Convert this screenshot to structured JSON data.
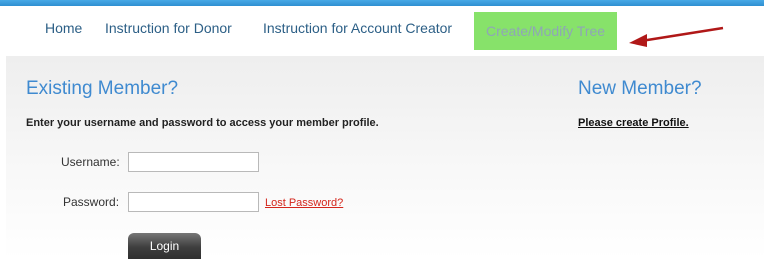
{
  "nav": {
    "items": [
      {
        "label": "Home"
      },
      {
        "label": "Instruction for Donor"
      },
      {
        "label": "Instruction for Account Creator"
      },
      {
        "label": "Create/Modify Tree"
      }
    ],
    "active_color": "#87e26a",
    "arrow_color": "#b01818"
  },
  "existing": {
    "heading": "Existing Member?",
    "instructions": "Enter your username and password to access your member profile.",
    "username_label": "Username:",
    "username_value": "",
    "password_label": "Password:",
    "password_value": "",
    "lost_password": "Lost Password?",
    "login_button": "Login"
  },
  "new_member": {
    "heading": "New Member?",
    "create_link": "Please create Profile."
  }
}
